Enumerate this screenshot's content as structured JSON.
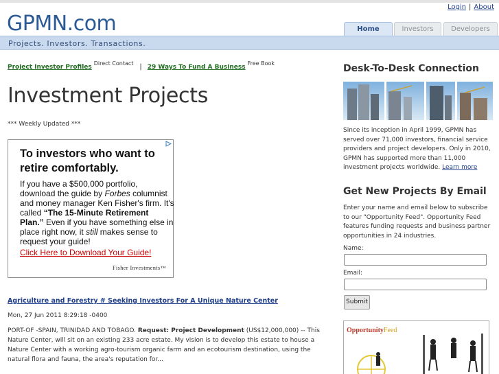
{
  "header": {
    "logo": "GPMN.com",
    "tagline": "Projects. Investors. Transactions.",
    "login": "Login",
    "separator": "|",
    "about": "About"
  },
  "tabs": [
    {
      "label": "Home",
      "active": true
    },
    {
      "label": "Investors",
      "active": false
    },
    {
      "label": "Developers",
      "active": false
    }
  ],
  "crumbs": {
    "link1": "Project Investor Profiles",
    "note1": "Direct Contact",
    "separator": "|",
    "link2": "29 Ways To Fund A Business",
    "note2": "Free Book"
  },
  "main": {
    "title": "Investment Projects",
    "updated": "*** Weekly Updated ***"
  },
  "ad": {
    "headline": "To investors who want to retire comfortably.",
    "body_1": "If you have a $500,000 portfolio, download the guide by ",
    "body_forbes": "Forbes",
    "body_2": " columnist and money manager Ken Fisher's firm. It's called ",
    "body_bold": "“The 15-Minute Retirement Plan.”",
    "body_3": " Even if you have something else in place right now, it ",
    "body_still": "still",
    "body_4": " makes sense to request your guide!",
    "link": "Click Here to Download Your Guide!",
    "brand": "Fisher Investments™"
  },
  "article": {
    "title": "Agriculture and Forestry # Seeking Investors For A Unique Nature Center",
    "date": "Mon, 27 Jun 2011 8:29:18 -0400",
    "lead": "PORT-OF -SPAIN, TRINIDAD AND TOBAGO. ",
    "request": "Request: Project Development",
    "body": " (US$12,000,000) -- This Nature Center, will sit on an existing 233 acre estate. My vision is to develop this estate to house a Nature Center with a working agro-tourism organic farm and an ecotourism destination, using the natural flora and fauna, the area's reputation for..."
  },
  "sidebar": {
    "heading1": "Desk-To-Desk Connection",
    "para1": "Since its inception in April 1999, GPMN has served over 71,000 investors, financial service providers and project developers. Only in 2010, GPMN has supported more than 11,000 investment projects worldwide. ",
    "learn_more": "Learn more",
    "heading2": "Get New Projects By Email",
    "para2": "Enter your name and email below to subscribe to our \"Opportunity Feed\". Opportunity Feed features funding requests and business partner opportunities in 24 industries.",
    "name_label": "Name:",
    "email_label": "Email:",
    "submit": "Submit",
    "feed_logo_a": "Opportunity",
    "feed_logo_b": "Feed"
  },
  "colors": {
    "brand": "#2b5a95",
    "nav_bar": "#c9d9ee",
    "link_green": "#1f6b1f",
    "link_blue": "#1f3f8a",
    "ad_link": "#cc0000"
  }
}
